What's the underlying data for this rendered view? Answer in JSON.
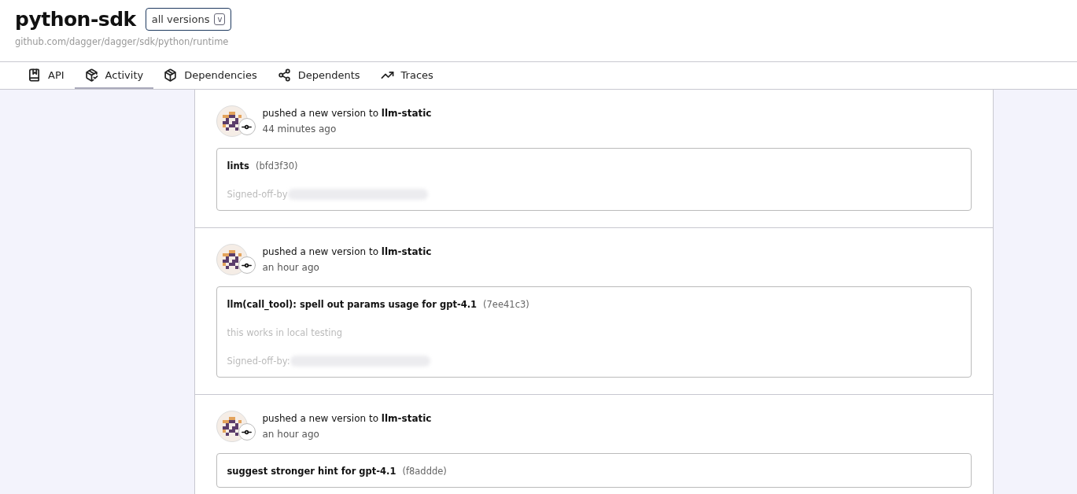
{
  "header": {
    "title": "python-sdk",
    "version_select": "all versions",
    "version_caret": "v",
    "path": "github.com/dagger/dagger/sdk/python/runtime"
  },
  "tabs": [
    {
      "label": "API",
      "selected": false
    },
    {
      "label": "Activity",
      "selected": true
    },
    {
      "label": "Dependencies",
      "selected": false
    },
    {
      "label": "Dependents",
      "selected": false
    },
    {
      "label": "Traces",
      "selected": false
    }
  ],
  "feed": [
    {
      "action": "pushed a new version to",
      "target": "llm-static",
      "time": "44 minutes ago",
      "commit": {
        "title": "lints",
        "hash": "(bfd3f30)",
        "body": [
          {
            "text": "Signed-off-by",
            "redacted": true
          }
        ]
      }
    },
    {
      "action": "pushed a new version to",
      "target": "llm-static",
      "time": "an hour ago",
      "commit": {
        "title": "llm(call_tool): spell out params usage for gpt-4.1",
        "hash": "(7ee41c3)",
        "body": [
          {
            "text": "this works in local testing",
            "redacted": false
          },
          {
            "text": "Signed-off-by:",
            "redacted": true
          }
        ]
      }
    },
    {
      "action": "pushed a new version to",
      "target": "llm-static",
      "time": "an hour ago",
      "commit": {
        "title": "suggest stronger hint for gpt-4.1",
        "hash": "(f8addde)"
      }
    }
  ]
}
